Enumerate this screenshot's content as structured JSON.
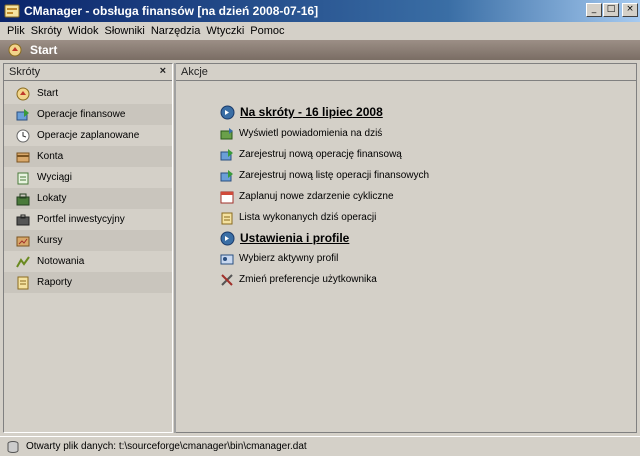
{
  "window": {
    "title": "CManager - obsługa finansów [na dzień 2008-07-16]",
    "buttons": {
      "minimize": "_",
      "maximize": "□",
      "close": "×"
    }
  },
  "menu": {
    "items": [
      "Plik",
      "Skróty",
      "Widok",
      "Słowniki",
      "Narzędzia",
      "Wtyczki",
      "Pomoc"
    ]
  },
  "header": {
    "title": "Start"
  },
  "sidebar": {
    "title": "Skróty",
    "close": "×",
    "items": [
      {
        "label": "Start",
        "icon": "start-icon"
      },
      {
        "label": "Operacje finansowe",
        "icon": "operations-icon"
      },
      {
        "label": "Operacje zaplanowane",
        "icon": "clock-icon"
      },
      {
        "label": "Konta",
        "icon": "accounts-icon"
      },
      {
        "label": "Wyciągi",
        "icon": "statements-icon"
      },
      {
        "label": "Lokaty",
        "icon": "deposits-icon"
      },
      {
        "label": "Portfel inwestycyjny",
        "icon": "portfolio-icon"
      },
      {
        "label": "Kursy",
        "icon": "rates-icon"
      },
      {
        "label": "Notowania",
        "icon": "quotes-icon"
      },
      {
        "label": "Raporty",
        "icon": "reports-icon"
      }
    ]
  },
  "main": {
    "title": "Akcje",
    "sections": [
      {
        "title": "Na skróty - 16 lipiec 2008",
        "actions": [
          "Wyświetl powiadomienia na dziś",
          "Zarejestruj nową operację finansową",
          "Zarejestruj nową listę operacji finansowych",
          "Zaplanuj nowe zdarzenie cykliczne",
          "Lista wykonanych dziś operacji"
        ]
      },
      {
        "title": "Ustawienia i profile",
        "actions": [
          "Wybierz aktywny profil",
          "Zmień preferencje użytkownika"
        ]
      }
    ]
  },
  "status": {
    "text": "Otwarty plik danych: t:\\sourceforge\\cmanager\\bin\\cmanager.dat"
  }
}
